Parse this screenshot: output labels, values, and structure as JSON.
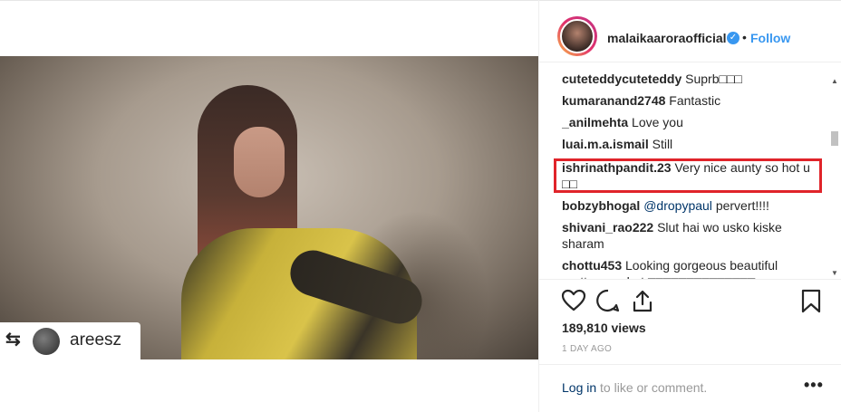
{
  "post": {
    "repost_author": "areesz"
  },
  "header": {
    "username": "malaikaaroraofficial",
    "separator": "•",
    "follow_label": "Follow"
  },
  "comments": [
    {
      "user": "cuteteddycuteteddy",
      "text": "Suprb□□□"
    },
    {
      "user": "kumaranand2748",
      "text": "Fantastic"
    },
    {
      "user": "_anilmehta",
      "text": "Love you"
    },
    {
      "user": "luai.m.a.ismail",
      "text": "Still"
    },
    {
      "user": "ishrinathpandit.23",
      "text": "Very nice aunty so hot u □□"
    },
    {
      "user": "bobzybhogal",
      "mention": "@dropypaul",
      "text": "pervert!!!!"
    },
    {
      "user": "shivani_rao222",
      "text": "Slut hai wo usko kiske sharam"
    },
    {
      "user": "chottu453",
      "text": "Looking gorgeous beautiful pretty sexy hot □□□□□□□□□□□□□□"
    }
  ],
  "stats": {
    "views": "189,810 views",
    "age": "1 DAY AGO"
  },
  "footer": {
    "login_link": "Log in",
    "login_rest": "to like or comment.",
    "more": "•••"
  },
  "colors": {
    "accent": "#3897f0",
    "highlight": "#e0242a"
  }
}
